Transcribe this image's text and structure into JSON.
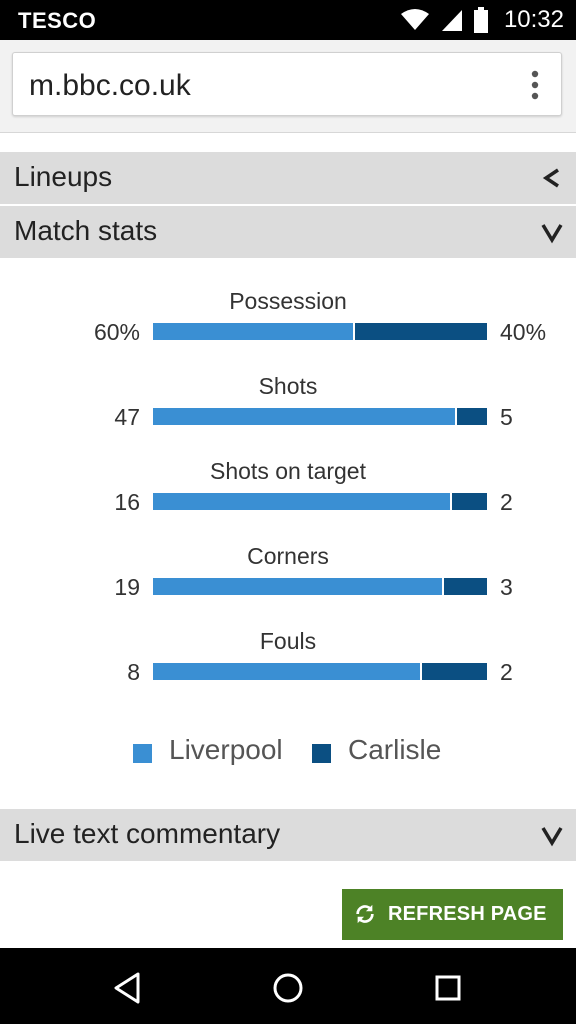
{
  "status_bar": {
    "carrier": "TESCO",
    "time": "10:32",
    "icons": [
      "wifi-icon",
      "signal-icon",
      "battery-icon"
    ]
  },
  "browser": {
    "url": "m.bbc.co.uk",
    "menu_icon": "overflow-menu-icon"
  },
  "sections": {
    "lineups": {
      "label": "Lineups",
      "icon": "chevron-left-icon"
    },
    "match_stats": {
      "label": "Match stats",
      "icon": "chevron-down-icon"
    },
    "live_commentary": {
      "label": "Live text commentary",
      "icon": "chevron-down-icon"
    }
  },
  "stats": [
    {
      "title": "Possession",
      "left": "60%",
      "right": "40%",
      "share_left": 0.6
    },
    {
      "title": "Shots",
      "left": "47",
      "right": "5",
      "share_left": 0.904
    },
    {
      "title": "Shots on target",
      "left": "16",
      "right": "2",
      "share_left": 0.889
    },
    {
      "title": "Corners",
      "left": "19",
      "right": "3",
      "share_left": 0.864
    },
    {
      "title": "Fouls",
      "left": "8",
      "right": "2",
      "share_left": 0.8
    }
  ],
  "legend": {
    "team_a": "Liverpool",
    "team_b": "Carlisle"
  },
  "colors": {
    "team_a": "#3a8fd3",
    "team_b": "#0b4f82",
    "refresh_bg": "#4d8226",
    "section_bg": "#dcdcdc"
  },
  "refresh_button": {
    "label": "REFRESH PAGE",
    "icon": "refresh-icon"
  },
  "nav_bar": {
    "icons": [
      "back-icon",
      "home-icon",
      "recents-icon"
    ]
  }
}
